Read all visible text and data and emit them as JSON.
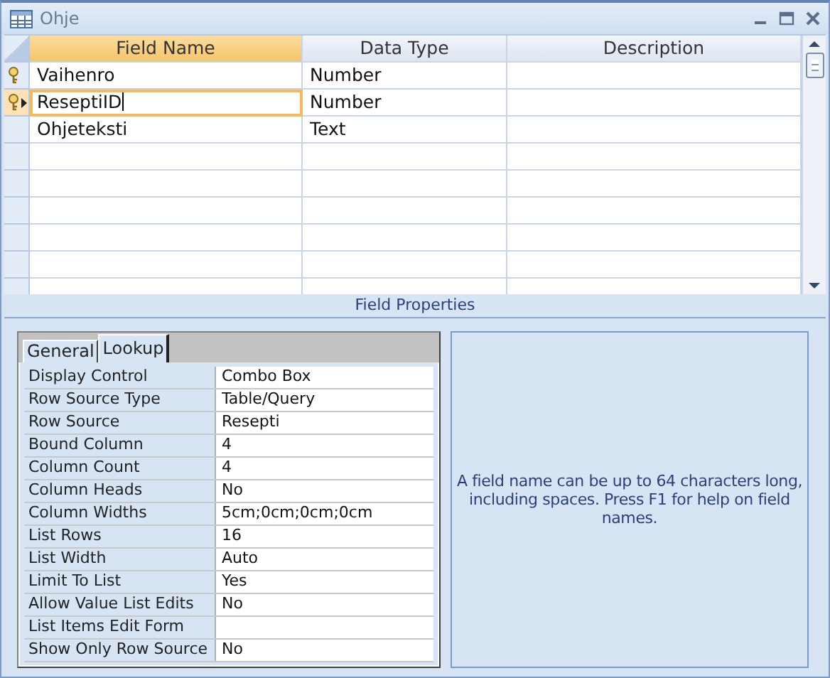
{
  "window": {
    "title": "Ohje"
  },
  "table": {
    "columns": [
      "Field Name",
      "Data Type",
      "Description"
    ],
    "rows": [
      {
        "field_name": "Vaihenro",
        "data_type": "Number",
        "primary_key": true,
        "current": false
      },
      {
        "field_name": "ReseptiID",
        "data_type": "Number",
        "primary_key": true,
        "current": true
      },
      {
        "field_name": "Ohjeteksti",
        "data_type": "Text",
        "primary_key": false,
        "current": false
      }
    ]
  },
  "field_properties": {
    "title": "Field Properties",
    "tabs": [
      {
        "label": "General",
        "selected": false
      },
      {
        "label": "Lookup",
        "selected": true
      }
    ],
    "properties": [
      {
        "name": "Display Control",
        "value": "Combo Box"
      },
      {
        "name": "Row Source Type",
        "value": "Table/Query"
      },
      {
        "name": "Row Source",
        "value": "Resepti"
      },
      {
        "name": "Bound Column",
        "value": "4"
      },
      {
        "name": "Column Count",
        "value": "4"
      },
      {
        "name": "Column Heads",
        "value": "No"
      },
      {
        "name": "Column Widths",
        "value": "5cm;0cm;0cm;0cm"
      },
      {
        "name": "List Rows",
        "value": "16"
      },
      {
        "name": "List Width",
        "value": "Auto"
      },
      {
        "name": "Limit To List",
        "value": "Yes"
      },
      {
        "name": "Allow Value List Edits",
        "value": "No"
      },
      {
        "name": "List Items Edit Form"
      },
      {
        "name": "Show Only Row Source",
        "value": "No"
      }
    ],
    "help_text": "A field name can be up to 64 characters long, including spaces.  Press F1 for help on field names."
  }
}
